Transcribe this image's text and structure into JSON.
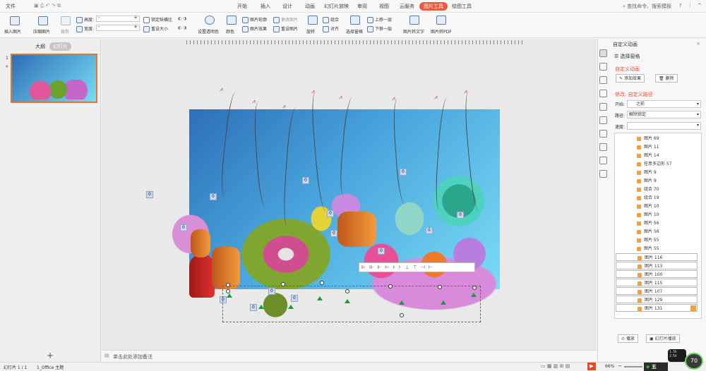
{
  "menubar": {
    "file": "文件",
    "tabs": [
      "开始",
      "插入",
      "设计",
      "动画",
      "幻灯片放映",
      "审阅",
      "视图",
      "云服务",
      "图片工具",
      "绘图工具"
    ],
    "search": "查找命令、搜索模板"
  },
  "ribbon": {
    "insert_image": "插入图片",
    "compress": "压缩图片",
    "crop": "裁剪",
    "height_label": "高度:",
    "width_label": "宽度:",
    "lock_ratio": "锁定纵横比",
    "reset_size": "重设大小",
    "transparent": "设置透明色",
    "color": "颜色",
    "outline": "图片轮廓",
    "effect": "图片效果",
    "change": "更改图片",
    "reset": "重设图片",
    "rotate": "旋转",
    "group": "组合",
    "align": "对齐",
    "selection": "选择窗格",
    "bring_forward": "上移一层",
    "send_backward": "下移一层",
    "to_text": "图片转文字",
    "to_pdf": "图片转PDF"
  },
  "left": {
    "outline_tab": "大纲",
    "slides_tab": "幻灯片",
    "slide_no": "1"
  },
  "notes": "单击此处添加备注",
  "right": {
    "title": "自定义动画",
    "select_pane": "选择窗格",
    "section": "自定义动画",
    "add_effect": "添加效果",
    "delete": "删除",
    "modify": "修改: 自定义路径",
    "start_label": "开始:",
    "start_value": "之前",
    "path_label": "路径:",
    "path_value": "解除锁定",
    "speed_label": "速度:",
    "items": [
      "图片 69",
      "图片 11",
      "图片 14",
      "任意多边形 57",
      "图片 9",
      "图片 9",
      "组合 70",
      "组合 19",
      "图片 10",
      "图片 10",
      "图片 56",
      "图片 56",
      "图片 55",
      "图片 55"
    ],
    "boxed_items": [
      "图片 116",
      "图片 113",
      "图片 100",
      "图片 115",
      "图片 107",
      "图片 129",
      "图片 131"
    ],
    "play": "播放",
    "slideshow": "幻灯片播放"
  },
  "status": {
    "slide": "幻灯片 1 / 1",
    "theme": "1_Office 主题",
    "zoom": "66%"
  },
  "badges": [
    "0",
    "0",
    "0",
    "0",
    "0",
    "0",
    "0",
    "0",
    "0",
    "0",
    "0",
    "0",
    "0",
    "0"
  ],
  "overlay": {
    "speed": "70",
    "up": "1.3k",
    "down": "2.5k",
    "brand": "五"
  }
}
